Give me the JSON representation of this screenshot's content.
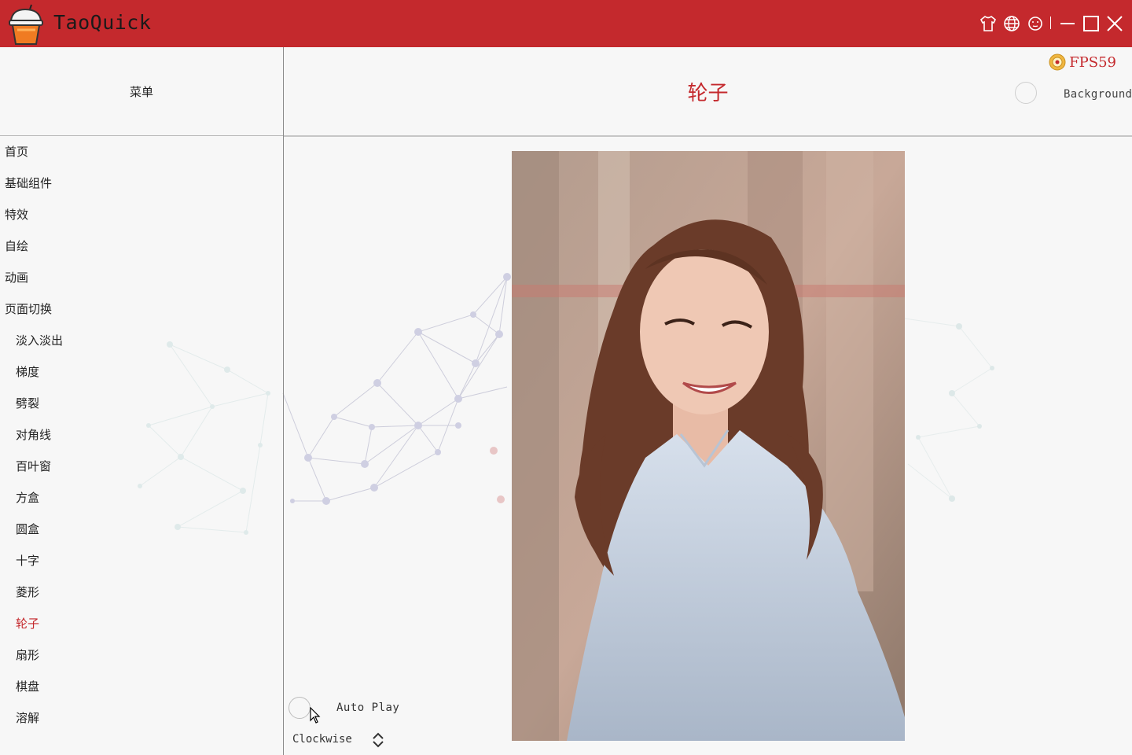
{
  "window": {
    "title": "TaoQuick",
    "controls": [
      "skin-icon",
      "language-icon",
      "about-icon",
      "minimize-icon",
      "maximize-icon",
      "close-icon"
    ]
  },
  "colors": {
    "accent": "#c4292d",
    "background": "#f7f7f7"
  },
  "sidebar": {
    "header": "菜单",
    "items": [
      {
        "label": "首页",
        "level": 0
      },
      {
        "label": "基础组件",
        "level": 0
      },
      {
        "label": "特效",
        "level": 0
      },
      {
        "label": "自绘",
        "level": 0
      },
      {
        "label": "动画",
        "level": 0
      },
      {
        "label": "页面切换",
        "level": 0
      },
      {
        "label": "淡入淡出",
        "level": 1
      },
      {
        "label": "梯度",
        "level": 1
      },
      {
        "label": "劈裂",
        "level": 1
      },
      {
        "label": "对角线",
        "level": 1
      },
      {
        "label": "百叶窗",
        "level": 1
      },
      {
        "label": "方盒",
        "level": 1
      },
      {
        "label": "圆盒",
        "level": 1
      },
      {
        "label": "十字",
        "level": 1
      },
      {
        "label": "菱形",
        "level": 1
      },
      {
        "label": "轮子",
        "level": 1,
        "active": true
      },
      {
        "label": "扇形",
        "level": 1
      },
      {
        "label": "棋盘",
        "level": 1
      },
      {
        "label": "溶解",
        "level": 1
      }
    ]
  },
  "content": {
    "title": "轮子",
    "fps_label": "FPS59",
    "background_label": "Background",
    "autoplay_label": "Auto Play",
    "direction_label": "Clockwise"
  }
}
